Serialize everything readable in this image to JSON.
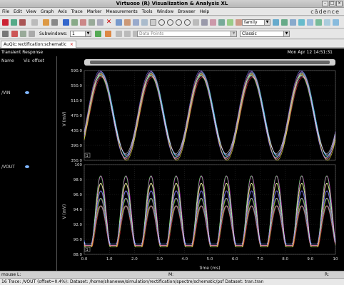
{
  "window": {
    "title": "Virtuoso (R) Visualization & Analysis XL",
    "brand": "cādence"
  },
  "menu": [
    "File",
    "Edit",
    "View",
    "Graph",
    "Axis",
    "Trace",
    "Marker",
    "Measurements",
    "Tools",
    "Window",
    "Browser",
    "Help"
  ],
  "toolbar": {
    "family_value": "family",
    "subwindows_label": "Subwindows:",
    "subwindows_value": "1",
    "data_point_placeholder": "Data Points",
    "theme_value": "Classic"
  },
  "tab": {
    "label": "AuQic:rectification:schematic"
  },
  "graph": {
    "title": "Transient Response",
    "timestamp": "Mon Apr 12 14:51:31"
  },
  "panel": {
    "col_name": "Name",
    "col_vis": "Vis",
    "col_offset": "offset",
    "signals": [
      "/VIN",
      "/VOUT"
    ]
  },
  "plot_top": {
    "ylabel": "V (mV)",
    "yticks": [
      "590.0",
      "550.0",
      "510.0",
      "470.0",
      "430.0",
      "390.0",
      "350.0"
    ],
    "ymin": 350,
    "ymax": 590,
    "badge": "1"
  },
  "plot_bottom": {
    "ylabel": "V (mV)",
    "yticks": [
      "100",
      "98.0",
      "96.0",
      "94.0",
      "92.0",
      "90.0",
      "88.0"
    ],
    "ymin": 88,
    "ymax": 100,
    "badge": "1"
  },
  "xaxis": {
    "label": "time (ms)",
    "ticks": [
      "0.0",
      "1.0",
      "2.0",
      "3.0",
      "4.0",
      "5.0",
      "6.0",
      "7.0",
      "8.0",
      "9.0",
      "10"
    ]
  },
  "status": {
    "line1_left": "mouse L:",
    "line1_mid": "M:",
    "line1_right": "R:",
    "line2": "16  Trace: /VOUT (offset=0.4%): Dataset: /home/shaneww/simulation/rectification/spectre/schematic/psf Dataset: tran.tran"
  },
  "colors": {
    "background": "#000000",
    "grid": "#3a3a3a",
    "axis_text": "#dddddd"
  }
}
